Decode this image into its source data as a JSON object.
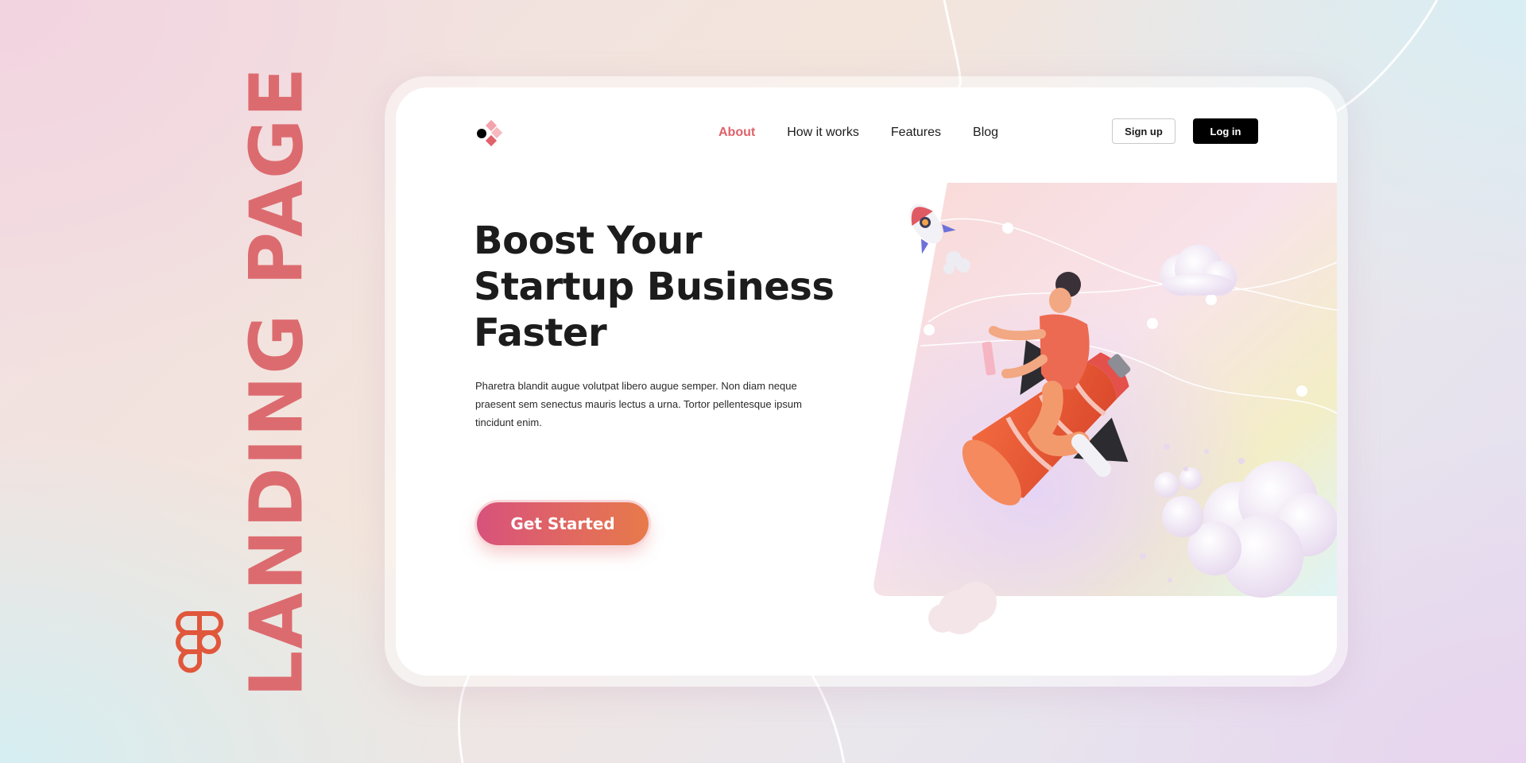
{
  "side_title": "LANDING PAGE",
  "nav": {
    "items": [
      {
        "label": "About",
        "active": true
      },
      {
        "label": "How it works",
        "active": false
      },
      {
        "label": "Features",
        "active": false
      },
      {
        "label": "Blog",
        "active": false
      }
    ]
  },
  "auth": {
    "signup_label": "Sign up",
    "login_label": "Log in"
  },
  "hero": {
    "headline_lines": [
      "Boost Your",
      "Startup Business",
      "Faster"
    ],
    "description": "Pharetra blandit augue volutpat libero augue semper. Non diam neque praesent sem senectus mauris lectus a urna. Tortor pellentesque ipsum tincidunt enim.",
    "cta_label": "Get Started",
    "illustration": "rocket-rider-illustration"
  },
  "icons": {
    "figma": "figma-logo-icon",
    "brand": "diamond-logo-icon",
    "small_rocket": "rocket-icon"
  },
  "colors": {
    "accent": "#e0626a",
    "side_title": "#dc6b6f",
    "cta_start": "#d8527c",
    "cta_end": "#e77a4a",
    "login_bg": "#000000"
  }
}
